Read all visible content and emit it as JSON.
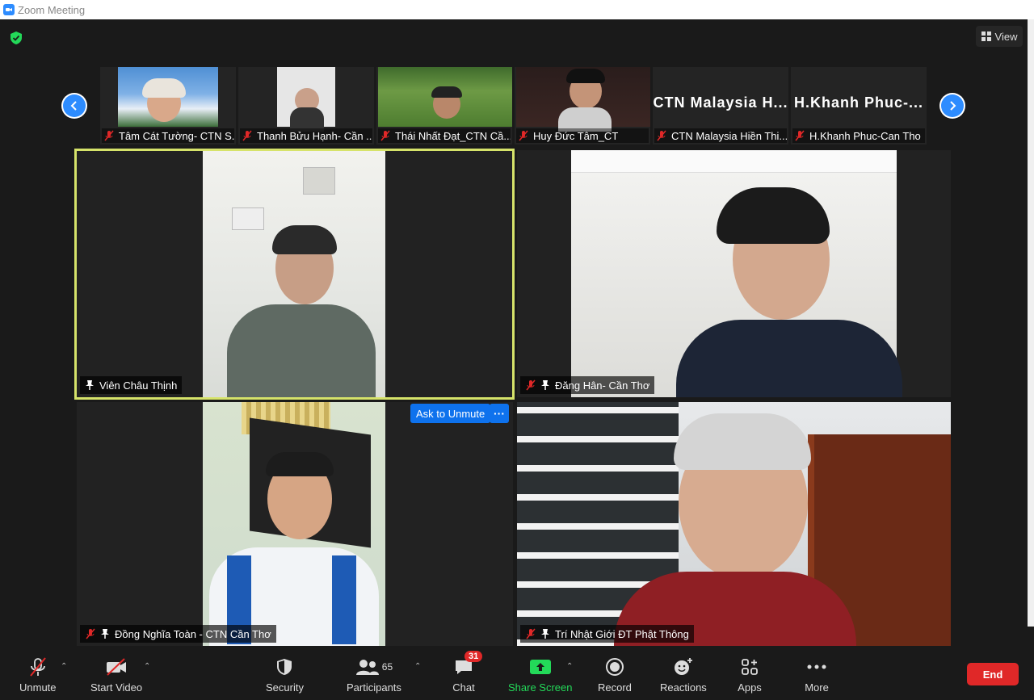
{
  "window": {
    "title": "Zoom Meeting"
  },
  "header": {
    "view_label": "View"
  },
  "strip": {
    "thumbs": [
      {
        "name": "Tâm Cát Tường- CTN S..."
      },
      {
        "name": "Thanh Bửu Hạnh- Cần ..."
      },
      {
        "name": "Thái Nhất Đạt_CTN Cầ..."
      },
      {
        "name": "Huy Đức Tâm_CT"
      },
      {
        "name": "CTN Malaysia Hiền Thi...",
        "display": "CTN  Malaysia  H..."
      },
      {
        "name": "H.Khanh Phuc-Can Tho",
        "display": "H.Khanh  Phuc-..."
      }
    ]
  },
  "tiles": [
    {
      "name": "Viên Châu Thịnh"
    },
    {
      "name": "Đăng Hân- Cần Thơ"
    },
    {
      "name": "Đồng Nghĩa Toàn - CTN Cần Thơ"
    },
    {
      "name": "Trí Nhật Giới ĐT Phật Thông"
    }
  ],
  "tile_actions": {
    "ask_to_unmute": "Ask to Unmute",
    "more": "···"
  },
  "toolbar": {
    "unmute": "Unmute",
    "start_video": "Start Video",
    "security": "Security",
    "participants": "Participants",
    "participants_count": "65",
    "chat": "Chat",
    "chat_badge": "31",
    "share_screen": "Share Screen",
    "record": "Record",
    "reactions": "Reactions",
    "apps": "Apps",
    "more": "More",
    "end": "End"
  },
  "colors": {
    "accent": "#2d8cff",
    "share_green": "#23d959",
    "end_red": "#e02828",
    "speaker_border": "#d6e36a"
  }
}
